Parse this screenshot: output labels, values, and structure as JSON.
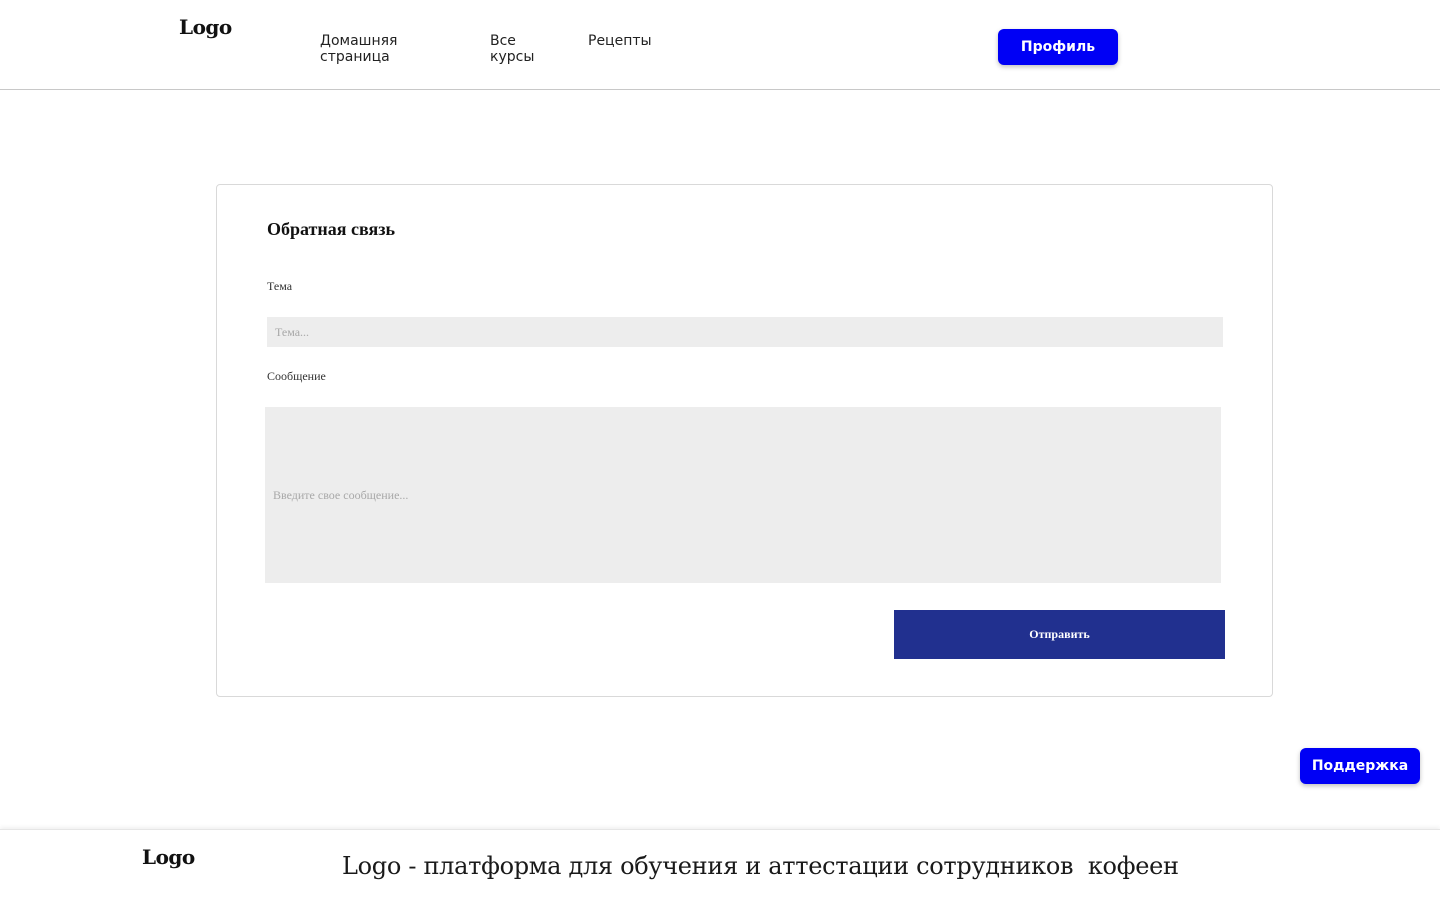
{
  "header": {
    "logo": "Logo",
    "nav": [
      {
        "label": "Домашняя страница"
      },
      {
        "label": "Все курсы"
      },
      {
        "label": "Рецепты"
      }
    ],
    "profile_button": "Профиль"
  },
  "feedback": {
    "title": "Обратная связь",
    "topic_label": "Тема",
    "topic_placeholder": "Тема...",
    "message_label": "Сообщение",
    "message_placeholder": "Введите свое сообщение...",
    "submit_button": "Отправить"
  },
  "support_button": "Поддержка",
  "footer": {
    "logo": "Logo",
    "tagline": "Logo - платформа для обучения и аттестации сотрудников  кофеен"
  },
  "colors": {
    "accent_blue": "#0000f5",
    "submit_navy": "#21308f",
    "input_gray": "#ededed"
  }
}
